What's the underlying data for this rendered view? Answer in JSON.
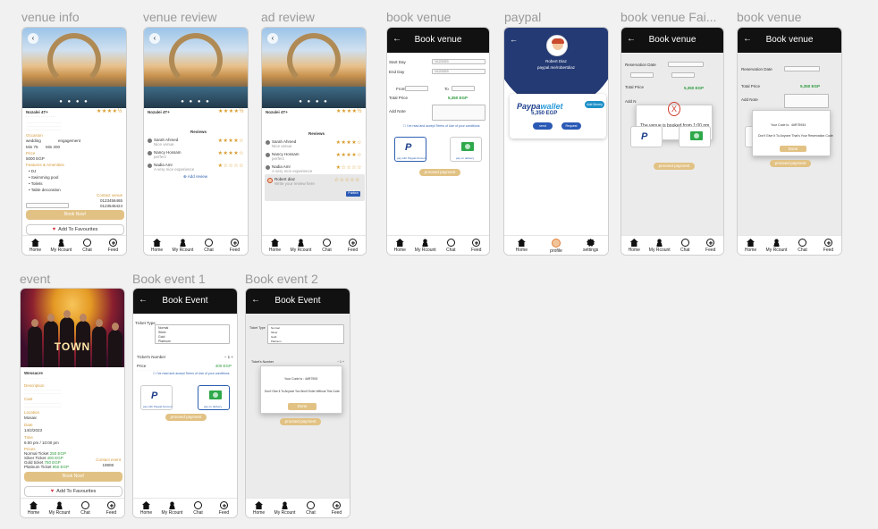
{
  "frames": {
    "venue_info": {
      "label": "venue info"
    },
    "venue_review": {
      "label": "venue review"
    },
    "ad_review": {
      "label": "ad review"
    },
    "book_venue": {
      "label": "book venue"
    },
    "paypal": {
      "label": "paypal"
    },
    "book_venue_fail": {
      "label": "book venue Fai..."
    },
    "book_venue_2": {
      "label": "book venue"
    },
    "event": {
      "label": "event"
    },
    "book_event_1": {
      "label": "Book event 1"
    },
    "book_event_2": {
      "label": "Book event 2"
    }
  },
  "nav": {
    "home": "Home",
    "account": "My Rcount",
    "chat": "Chat",
    "feed": "Feed",
    "profile": "profile",
    "settings": "settings"
  },
  "venue": {
    "name": "Nozalei 4T+",
    "stars": "★★★★½",
    "occasion_label": "Occasion",
    "wedding": "wedding",
    "engagement": "engagement",
    "min": "Min 75",
    "max": "Min 200",
    "price_label": "Price",
    "price": "5000 EGP",
    "features_label": "Features & Amenities",
    "features": [
      "DJ",
      "Swimming pool",
      "Toilets",
      "Table decoration"
    ],
    "contact": "Contact venue",
    "phone1": "0123456465",
    "phone2": "0123546424",
    "book_now": "Book Now!",
    "add_fav": "Add To Favourites"
  },
  "review": {
    "name": "Nozalei 4T+",
    "stars": "★★★★½",
    "title": "Reviews",
    "items": [
      {
        "name": "Sarah Ahmed",
        "text": "Nice venue",
        "stars": "★★★★☆"
      },
      {
        "name": "Nancy Hossam",
        "text": "perfect",
        "stars": "★★★★☆"
      },
      {
        "name": "Nadia Amr",
        "text": "A very nice experience",
        "stars": "★☆☆☆☆"
      }
    ],
    "add_review": "Add review",
    "new_name": "Robert diaz",
    "new_placeholder": "Write your review here",
    "publish": "Publish"
  },
  "book_venue": {
    "title": "Book venue",
    "start_day": "Start Day",
    "end_day": "End Day",
    "from": "From",
    "to": "To",
    "date_val": "1/12/2023",
    "total_price": "Total Price",
    "price": "5,350 EGP",
    "add_note": "Add Note",
    "terms": "I've read and accept Terms of Use of your conditions",
    "paypal_caption": "pay with Paypal Account",
    "cash_caption": "pay on delivery",
    "proceed": "proceed payment"
  },
  "paypal": {
    "name": "Robert Diaz",
    "handle": "paypal.me/robertdiaz",
    "wallet_a": "Paypa",
    "wallet_b": "wallet",
    "amount": "5,350 EGP",
    "add_money": "Add Money",
    "send": "send",
    "request": "Request"
  },
  "fail": {
    "title": "Book venue",
    "res_date": "Reservation Date",
    "total_price": "Total Price",
    "price": "5,350 EGP",
    "add_note": "Add N",
    "msg": "The venue is booked from 1:00 pm to 6:00 pm",
    "proceed": "proceed payment"
  },
  "success": {
    "title": "Book venue",
    "res_date": "Reservation Date",
    "total_price": "Total Price",
    "price": "5,350 EGP",
    "add_note": "Add Note",
    "code": "Your Code Is : 4#R75934",
    "msg": "Don't Give It To Anyone That's Your Reservation Code",
    "done": "Done",
    "proceed": "proceed payment"
  },
  "event": {
    "poster_title": "TOWN",
    "name": "Wessacre",
    "desc_label": "Description",
    "cast_label": "Cast",
    "location_label": "Location",
    "location": "Mosaic",
    "date_label": "Date",
    "date": "14/2/2023",
    "time_label": "Time",
    "time": "6:00 pm / 10:00 pm",
    "prices_label": "Prices",
    "prices": [
      {
        "name": "Normal Ticket",
        "price": "250 EGP"
      },
      {
        "name": "Silver Ticket",
        "price": "400 EGP"
      },
      {
        "name": "Gold ticket",
        "price": "750 EGP"
      },
      {
        "name": "Platinum Ticket",
        "price": "950 EGP"
      }
    ],
    "contact": "Contact event",
    "phone": "19808",
    "book_now": "Book Now!",
    "add_fav": "Add To Favourites"
  },
  "book_event": {
    "title": "Book Event",
    "ticket_type": "Ticket Type",
    "types": [
      "Normal",
      "Silver",
      "Gold",
      "Platinum"
    ],
    "tickets_number": "Ticket's Number",
    "qty": "1",
    "price": "Price",
    "price_val": "400 EGP",
    "terms": "I've read and accept Terms of Use of your conditions",
    "paypal_caption": "pay with Paypal Account",
    "cash_caption": "pay on delivery",
    "proceed": "proceed payment",
    "code": "Your Code Is : 4#R7593",
    "msg": "Don't Give It To Anyone You Won't Enter Without This Code",
    "done": "Done"
  }
}
